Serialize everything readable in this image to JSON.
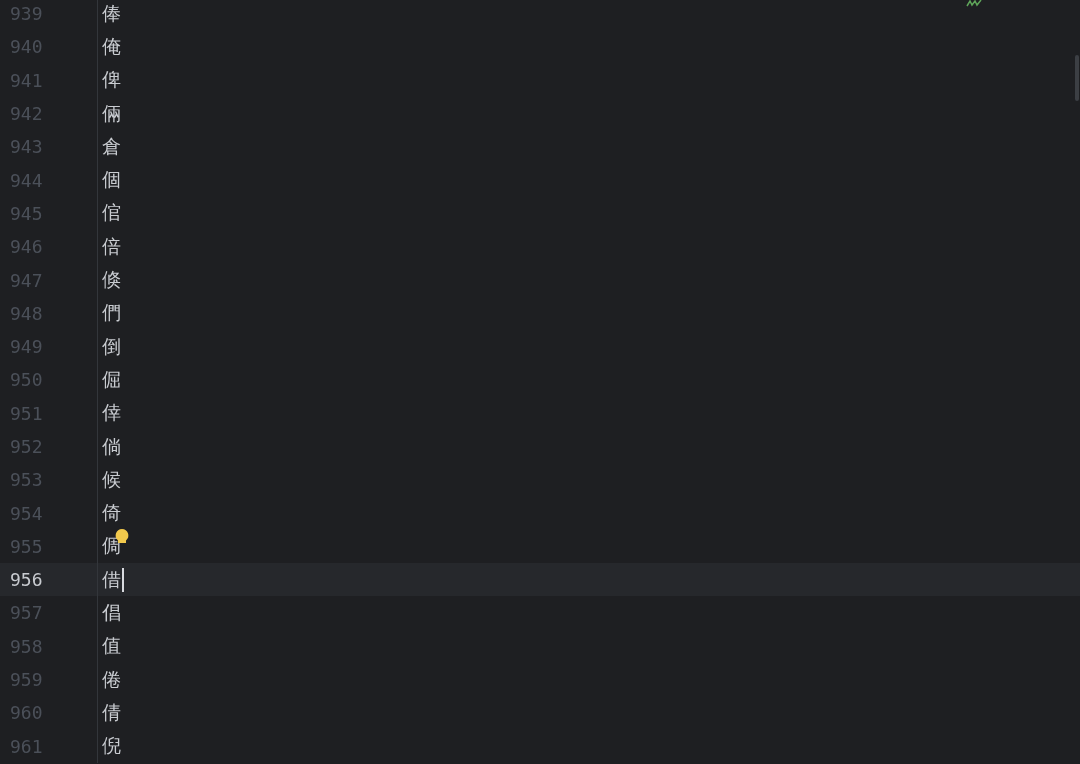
{
  "editor": {
    "lines": [
      {
        "number": "939",
        "text": "俸",
        "current": false,
        "hint": false
      },
      {
        "number": "940",
        "text": "俺",
        "current": false,
        "hint": false
      },
      {
        "number": "941",
        "text": "俾",
        "current": false,
        "hint": false
      },
      {
        "number": "942",
        "text": "倆",
        "current": false,
        "hint": false
      },
      {
        "number": "943",
        "text": "倉",
        "current": false,
        "hint": false
      },
      {
        "number": "944",
        "text": "個",
        "current": false,
        "hint": false
      },
      {
        "number": "945",
        "text": "倌",
        "current": false,
        "hint": false
      },
      {
        "number": "946",
        "text": "倍",
        "current": false,
        "hint": false
      },
      {
        "number": "947",
        "text": "倏",
        "current": false,
        "hint": false
      },
      {
        "number": "948",
        "text": "們",
        "current": false,
        "hint": false
      },
      {
        "number": "949",
        "text": "倒",
        "current": false,
        "hint": false
      },
      {
        "number": "950",
        "text": "倔",
        "current": false,
        "hint": false
      },
      {
        "number": "951",
        "text": "倖",
        "current": false,
        "hint": false
      },
      {
        "number": "952",
        "text": "倘",
        "current": false,
        "hint": false
      },
      {
        "number": "953",
        "text": "候",
        "current": false,
        "hint": false
      },
      {
        "number": "954",
        "text": "倚",
        "current": false,
        "hint": false
      },
      {
        "number": "955",
        "text": "倜",
        "current": false,
        "hint": true
      },
      {
        "number": "956",
        "text": "借",
        "current": true,
        "hint": false
      },
      {
        "number": "957",
        "text": "倡",
        "current": false,
        "hint": false
      },
      {
        "number": "958",
        "text": "值",
        "current": false,
        "hint": false
      },
      {
        "number": "959",
        "text": "倦",
        "current": false,
        "hint": false
      },
      {
        "number": "960",
        "text": "倩",
        "current": false,
        "hint": false
      },
      {
        "number": "961",
        "text": "倪",
        "current": false,
        "hint": false
      }
    ]
  }
}
